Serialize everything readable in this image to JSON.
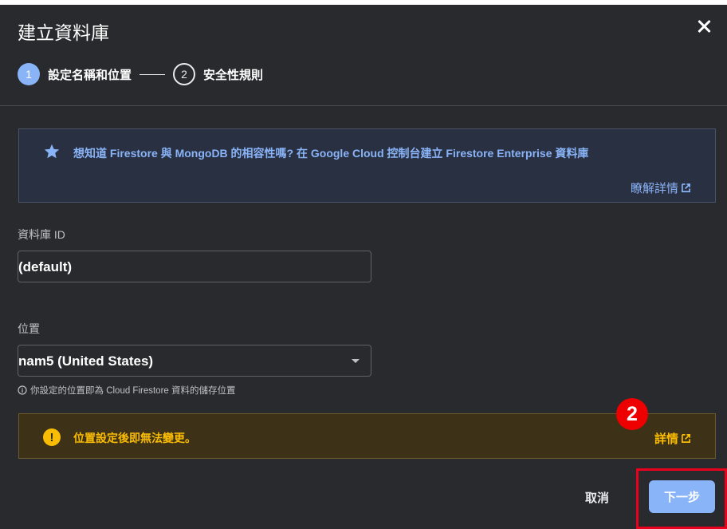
{
  "dialog": {
    "title": "建立資料庫",
    "steps": [
      {
        "number": "1",
        "label": "設定名稱和位置"
      },
      {
        "number": "2",
        "label": "安全性規則"
      }
    ]
  },
  "info_banner": {
    "text": "想知道 Firestore 與 MongoDB 的相容性嗎? 在 Google Cloud 控制台建立 Firestore Enterprise 資料庫",
    "link": "瞭解詳情",
    "icon": "star-icon"
  },
  "database_id": {
    "label": "資料庫 ID",
    "value": "(default)"
  },
  "location": {
    "label": "位置",
    "selected": "nam5 (United States)",
    "hint": "你設定的位置即為 Cloud Firestore 資料的儲存位置"
  },
  "warning_banner": {
    "text": "位置設定後即無法變更。",
    "icon": "!",
    "link": "詳情"
  },
  "annotation": {
    "marker": "2"
  },
  "buttons": {
    "cancel": "取消",
    "next": "下一步"
  },
  "colors": {
    "background": "#292a2d",
    "accent": "#8ab4f8",
    "warning": "#fbbc04",
    "annotation": "#ee0000"
  }
}
